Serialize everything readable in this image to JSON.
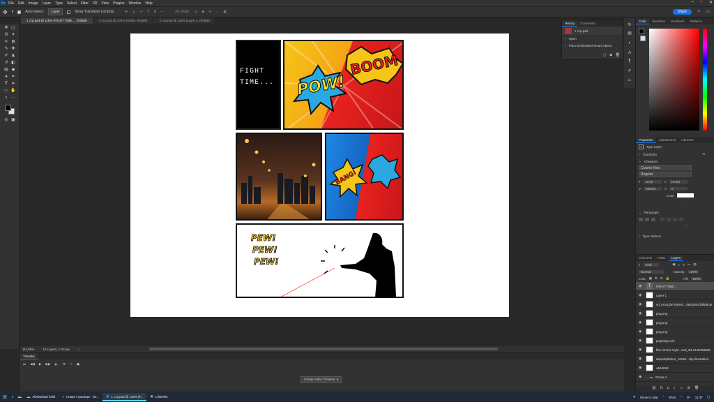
{
  "app": {
    "menu": [
      "File",
      "Edit",
      "Image",
      "Layer",
      "Type",
      "Select",
      "Filter",
      "3D",
      "View",
      "Plugins",
      "Window",
      "Help"
    ],
    "share_label": "Share"
  },
  "options_bar": {
    "auto_select_label": "Auto-Select:",
    "auto_select_value": "Layer",
    "transform_controls_label": "Show Transform Controls",
    "mode_3d_label": "3D Mode:"
  },
  "doc_tabs": [
    {
      "label": "1 стр.psd @ 115% (FIGHT TIME..., RGB/8)",
      "active": true
    },
    {
      "label": "2 стр.psd @ 101% (Glitter, RGB/8)",
      "active": false
    },
    {
      "label": "3 стр.psd @ 115% (Layer 3, RGB/8)",
      "active": false
    }
  ],
  "canvas": {
    "panel_text": "FIGHT TIME...",
    "boom_text": "BOOM",
    "pow_text": "POW!",
    "bang_text": "BANG!",
    "pew_lines": [
      "PEW!",
      "PEW!",
      "PEW!"
    ]
  },
  "history_panel": {
    "tabs": [
      "History",
      "Comments"
    ],
    "snapshot": "1 стр.psd",
    "items": [
      "Open",
      "Place Embedded Smart Object"
    ]
  },
  "color_panel": {
    "tabs": [
      "Color",
      "Swatches",
      "Gradients",
      "Patterns"
    ]
  },
  "properties_panel": {
    "tabs": [
      "Properties",
      "Adjustments",
      "Libraries"
    ],
    "layer_type": "Type Layer",
    "transform_label": "Transform",
    "character_label": "Character",
    "font_family": "Courier New",
    "font_style": "Regular",
    "font_size": "18 pt",
    "leading": "(Auto)",
    "tracking": "Metrics",
    "kerning": "0",
    "color_label": "Color",
    "paragraph_label": "Paragraph",
    "type_options_label": "Type Options"
  },
  "layers_panel": {
    "tabs": [
      "Channels",
      "Paths",
      "Layers"
    ],
    "kind_label": "Kind",
    "blend_mode": "Normal",
    "opacity_label": "Opacity:",
    "opacity_value": "100%",
    "lock_label": "Lock:",
    "fill_label": "Fill:",
    "fill_value": "100%",
    "layers": [
      {
        "name": "FIGHT TIME...",
        "kind": "text",
        "selected": true
      },
      {
        "name": "Layer 1",
        "kind": "pixel",
        "selected": false
      },
      {
        "name": "vd_ers4LjhFSxKHD...t9bcb004,f6f6f9.a2",
        "kind": "pixel",
        "selected": false
      },
      {
        "name": "png.png",
        "kind": "pixel",
        "selected": false
      },
      {
        "name": "png.png",
        "kind": "pixel",
        "selected": false
      },
      {
        "name": "png.png",
        "kind": "pixel",
        "selected": false
      },
      {
        "name": "pngwing.com",
        "kind": "pixel",
        "selected": false
      },
      {
        "name": "flat-comics-style...ond_23-2148759966",
        "kind": "pixel",
        "selected": false
      },
      {
        "name": "depositphotos_12235...city-illustration",
        "kind": "pixel",
        "selected": false
      },
      {
        "name": "464482d",
        "kind": "pixel",
        "selected": false
      },
      {
        "name": "Group 1",
        "kind": "group",
        "selected": false
      }
    ]
  },
  "status_bar": {
    "zoom": "114,95%",
    "info": "16 Layers, 1 Group"
  },
  "timeline": {
    "tab": "Timeline",
    "create_button": "Create Video Timeline"
  },
  "taskbar": {
    "items": [
      {
        "label": "Albdaul8ad failid",
        "active": false
      },
      {
        "label": "Новая страница - No...",
        "active": false
      },
      {
        "label": "1 стр.psd @ 115% (F...",
        "active": true
      },
      {
        "label": "Lõikerlist",
        "active": false
      }
    ],
    "weather": "Snow to stop",
    "lang": "ENG",
    "time": "11:37"
  },
  "colors": {
    "accent": "#1473e6",
    "canvas_bg": "#ffffff",
    "comic_yellow": "#f5c518",
    "comic_red": "#e8231e",
    "comic_blue": "#1e88e5"
  }
}
